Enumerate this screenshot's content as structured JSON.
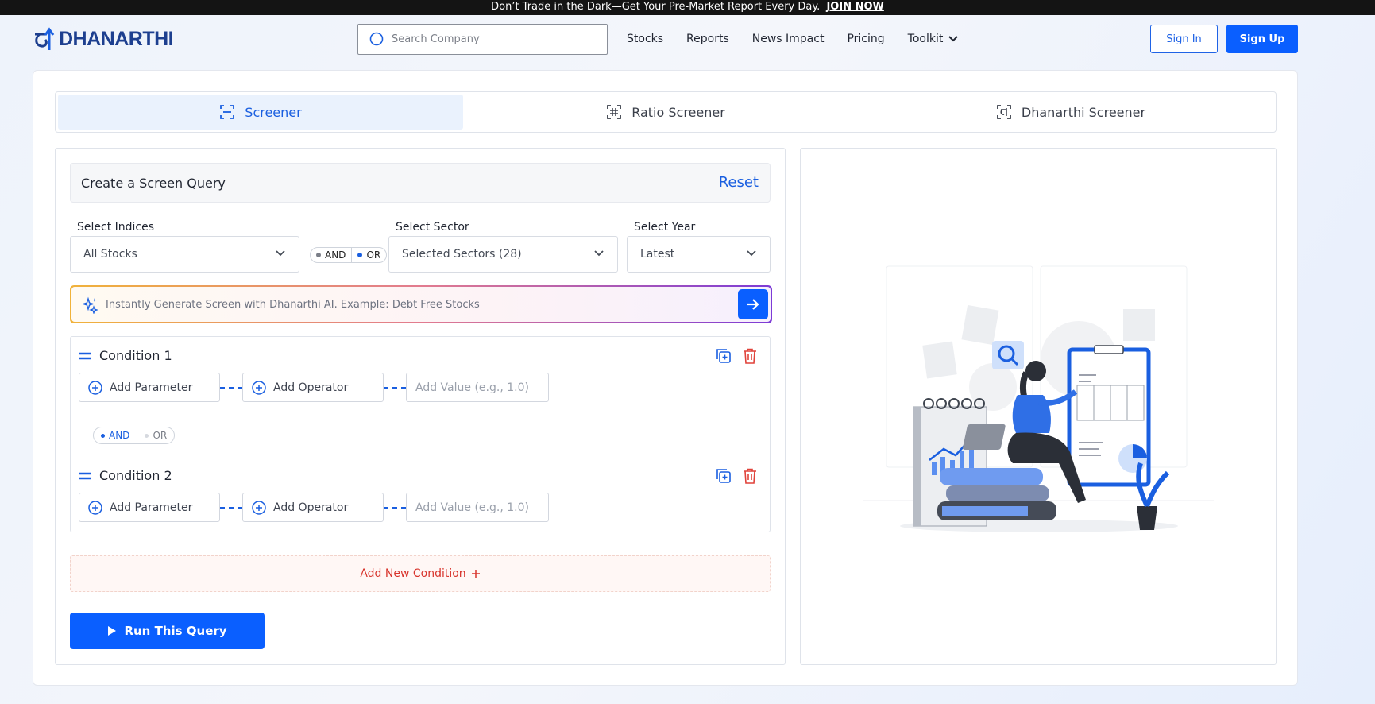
{
  "banner": {
    "text": "Don’t Trade in the Dark—Get Your Pre-Market Report Every Day.",
    "link": "JOIN NOW"
  },
  "brand": {
    "name": "DHANARTHI",
    "color": "#1d3f8f"
  },
  "search": {
    "placeholder": "Search Company"
  },
  "nav": {
    "items": [
      "Stocks",
      "Reports",
      "News Impact",
      "Pricing",
      "Toolkit"
    ]
  },
  "auth": {
    "sign_in": "Sign In",
    "sign_up": "Sign Up"
  },
  "tabs": [
    {
      "label": "Screener",
      "icon": "scan-icon",
      "active": true
    },
    {
      "label": "Ratio Screener",
      "icon": "ratio-icon",
      "active": false
    },
    {
      "label": "Dhanarthi Screener",
      "icon": "dhanarthi-scan-icon",
      "active": false
    }
  ],
  "query": {
    "title": "Create a Screen Query",
    "reset": "Reset"
  },
  "filters": {
    "indices_label": "Select Indices",
    "indices_value": "All Stocks",
    "sector_label": "Select Sector",
    "sector_value": "Selected Sectors (28)",
    "year_label": "Select Year",
    "year_value": "Latest",
    "join": {
      "and": "AND",
      "or": "OR",
      "selected": "OR"
    }
  },
  "ai": {
    "placeholder": "Instantly Generate Screen with Dhanarthi AI. Example: Debt Free Stocks"
  },
  "conditions": [
    {
      "title": "Condition 1",
      "parameter": "Add Parameter",
      "operator": "Add Operator",
      "value_placeholder": "Add Value (e.g., 1.0)"
    },
    {
      "title": "Condition 2",
      "parameter": "Add Parameter",
      "operator": "Add Operator",
      "value_placeholder": "Add Value (e.g., 1.0)"
    }
  ],
  "condition_join": {
    "and": "AND",
    "or": "OR",
    "selected": "AND"
  },
  "add_condition": "Add New Condition",
  "run_query": "Run This Query",
  "colors": {
    "primary": "#0a5fff",
    "danger": "#d8342c",
    "tab_active_bg": "#eaf2fd"
  }
}
